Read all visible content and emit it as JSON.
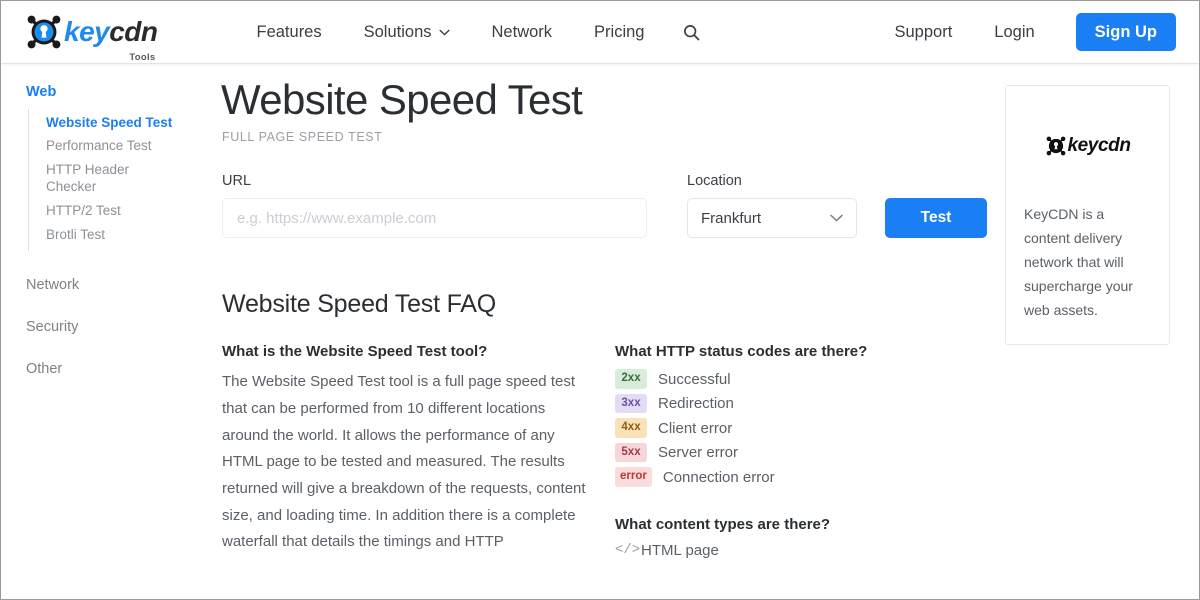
{
  "header": {
    "logo": {
      "key": "key",
      "cdn": "cdn",
      "tools": "Tools"
    },
    "nav": [
      {
        "label": "Features",
        "has_caret": false
      },
      {
        "label": "Solutions",
        "has_caret": true
      },
      {
        "label": "Network",
        "has_caret": false
      },
      {
        "label": "Pricing",
        "has_caret": false
      }
    ],
    "search_icon": "search-icon",
    "support_label": "Support",
    "login_label": "Login",
    "signup_label": "Sign Up",
    "accent_color": "#1a7ef5"
  },
  "sidebar": {
    "group_title": "Web",
    "items": [
      {
        "label": "Website Speed Test",
        "active": true
      },
      {
        "label": "Performance Test",
        "active": false
      },
      {
        "label": "HTTP Header Checker",
        "active": false
      },
      {
        "label": "HTTP/2 Test",
        "active": false
      },
      {
        "label": "Brotli Test",
        "active": false
      }
    ],
    "sections": [
      {
        "label": "Network"
      },
      {
        "label": "Security"
      },
      {
        "label": "Other"
      }
    ]
  },
  "main": {
    "title": "Website Speed Test",
    "subtitle": "FULL PAGE SPEED TEST",
    "form": {
      "url_label": "URL",
      "url_value": "",
      "url_placeholder": "e.g. https://www.example.com",
      "location_label": "Location",
      "location_value": "Frankfurt",
      "test_button": "Test"
    },
    "faq_title": "Website Speed Test FAQ",
    "faq_left": {
      "question": "What is the Website Speed Test tool?",
      "answer": "The Website Speed Test tool is a full page speed test that can be performed from 10 different locations around the world. It allows the performance of any HTML page to be tested and measured. The results returned will give a breakdown of the requests, content size, and loading time. In addition there is a complete waterfall that details the timings and HTTP"
    },
    "faq_right": {
      "question_status": "What HTTP status codes are there?",
      "status_codes": [
        {
          "code": "2xx",
          "name": "Successful",
          "bg": "#d7ecd9",
          "fg": "#3c6b40"
        },
        {
          "code": "3xx",
          "name": "Redirection",
          "bg": "#e4dcf5",
          "fg": "#6b4fa8"
        },
        {
          "code": "4xx",
          "name": "Client error",
          "bg": "#fbe2b6",
          "fg": "#8a5d18"
        },
        {
          "code": "5xx",
          "name": "Server error",
          "bg": "#f7d6da",
          "fg": "#a33a46"
        },
        {
          "code": "error",
          "name": "Connection error",
          "bg": "#fadcdc",
          "fg": "#c0392b"
        }
      ],
      "question_content": "What content types are there?",
      "content_types": [
        {
          "icon": "</>",
          "name": "HTML page"
        }
      ]
    }
  },
  "ad_card": {
    "logo_key": "key",
    "logo_cdn": "cdn",
    "text": "KeyCDN is a content delivery network that will supercharge your web assets."
  }
}
